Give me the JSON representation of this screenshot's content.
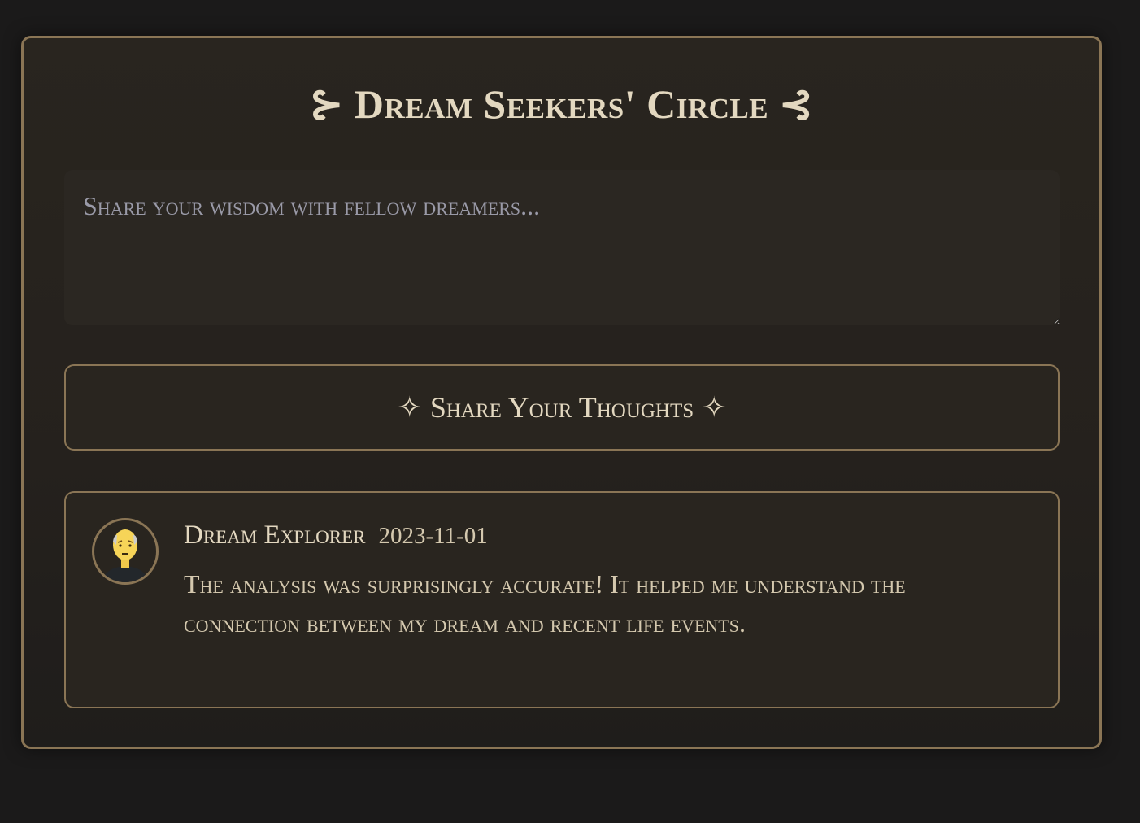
{
  "title": {
    "text": "Dream Seekers' Circle",
    "ornament_left": "⊱",
    "ornament_right": "⊰"
  },
  "comment_input": {
    "placeholder": "Share your wisdom with fellow dreamers...",
    "value": ""
  },
  "submit_button": {
    "label": "Share Your Thoughts",
    "icon": "✧"
  },
  "comments": [
    {
      "author": "Dream Explorer",
      "date": "2023-11-01",
      "avatar": "worried-person-avatar",
      "text": "The analysis was surprisingly accurate! It helped me understand the connection between my dream and recent life events."
    }
  ],
  "colors": {
    "accent": "#8a7555",
    "text": "#e3d8c0",
    "background": "#1b1a1a"
  }
}
